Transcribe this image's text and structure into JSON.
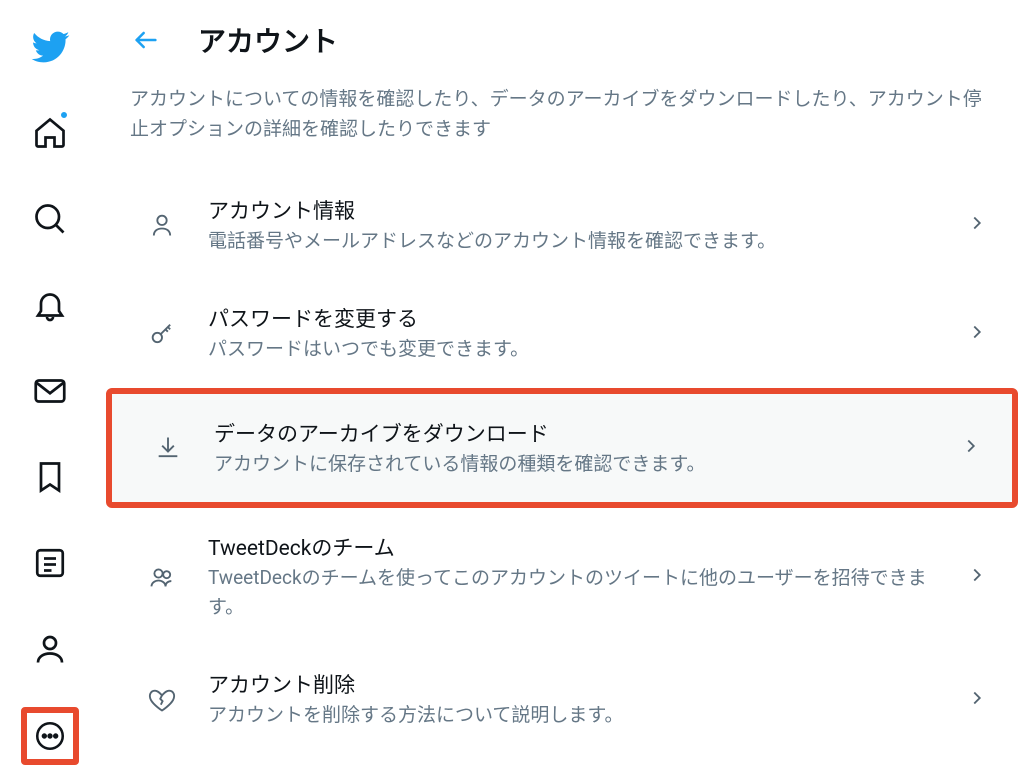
{
  "page": {
    "title": "アカウント",
    "description": "アカウントについての情報を確認したり、データのアーカイブをダウンロードしたり、アカウント停止オプションの詳細を確認したりできます"
  },
  "options": [
    {
      "title": "アカウント情報",
      "desc": "電話番号やメールアドレスなどのアカウント情報を確認できます。"
    },
    {
      "title": "パスワードを変更する",
      "desc": "パスワードはいつでも変更できます。"
    },
    {
      "title": "データのアーカイブをダウンロード",
      "desc": "アカウントに保存されている情報の種類を確認できます。"
    },
    {
      "title": "TweetDeckのチーム",
      "desc": "TweetDeckのチームを使ってこのアカウントのツイートに他のユーザーを招待できます。"
    },
    {
      "title": "アカウント削除",
      "desc": "アカウントを削除する方法について説明します。"
    }
  ]
}
